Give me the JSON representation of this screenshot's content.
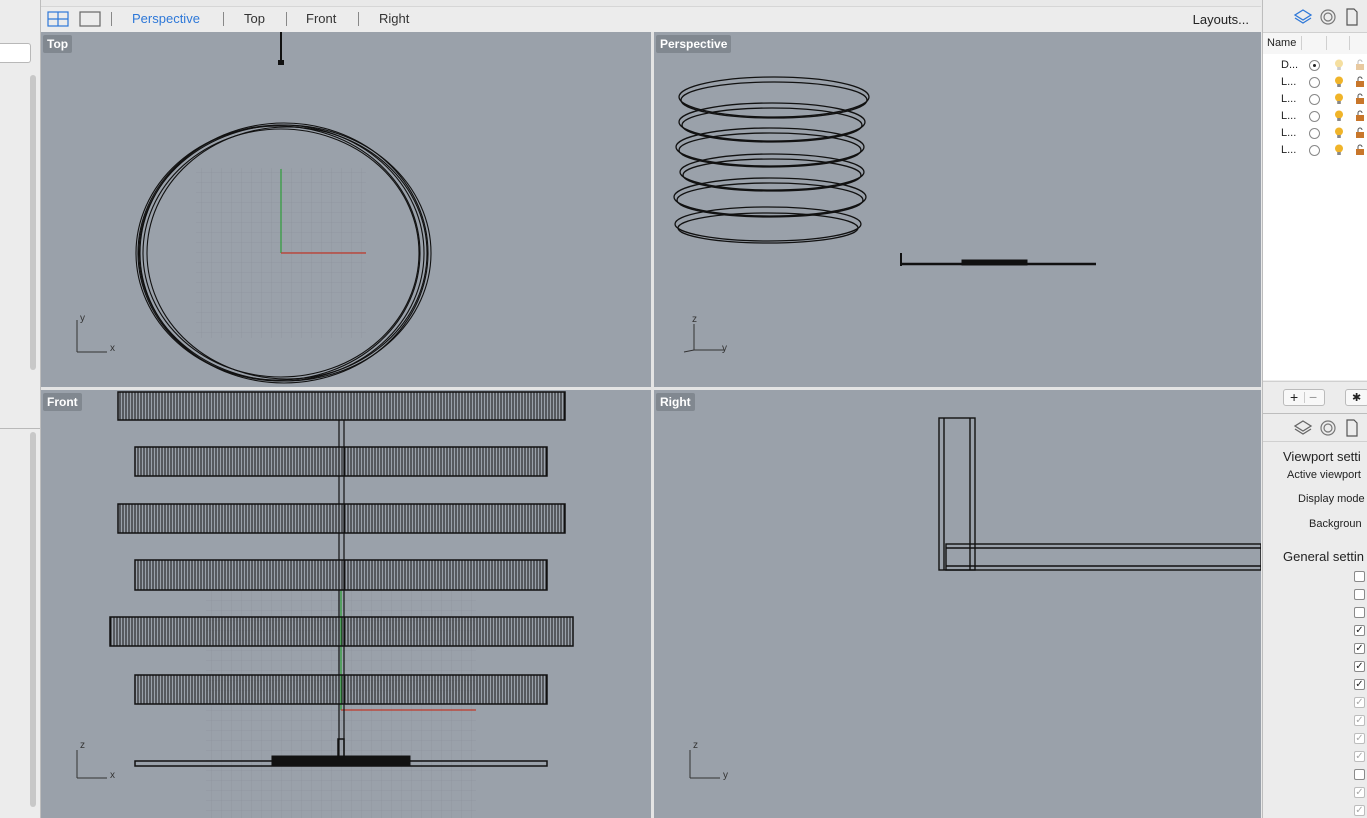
{
  "tabs": {
    "perspective": "Perspective",
    "top": "Top",
    "front": "Front",
    "right": "Right",
    "layouts": "Layouts..."
  },
  "viewports": {
    "top": "Top",
    "perspective": "Perspective",
    "front": "Front",
    "right": "Right"
  },
  "axes": {
    "top": {
      "a": "y",
      "b": "x"
    },
    "perspective": {
      "a": "z",
      "b": "y"
    },
    "front": {
      "a": "z",
      "b": "x"
    },
    "right": {
      "a": "z",
      "b": "y"
    }
  },
  "layers": {
    "header": "Name",
    "rows": [
      {
        "name": "D...",
        "current": true,
        "light": "dim"
      },
      {
        "name": "L...",
        "current": false,
        "light": "on"
      },
      {
        "name": "L...",
        "current": false,
        "light": "on"
      },
      {
        "name": "L...",
        "current": false,
        "light": "on"
      },
      {
        "name": "L...",
        "current": false,
        "light": "on"
      },
      {
        "name": "L...",
        "current": false,
        "light": "on"
      }
    ],
    "add": "+",
    "remove": "−",
    "gear": "✱"
  },
  "properties": {
    "viewport_settings": "Viewport setti",
    "active_viewport": "Active viewport",
    "display_mode": "Display mode",
    "background": "Backgroun",
    "general_settings": "General settin",
    "checkboxes": [
      false,
      false,
      false,
      true,
      true,
      true,
      true,
      "dim",
      "dim",
      "dim",
      "dim",
      false,
      "dim",
      "dim"
    ]
  },
  "colors": {
    "viewport_bg": "#9aa1aa",
    "accent": "#2e78d8",
    "axis_x": "#c0392b",
    "axis_y": "#2e9e3a"
  }
}
